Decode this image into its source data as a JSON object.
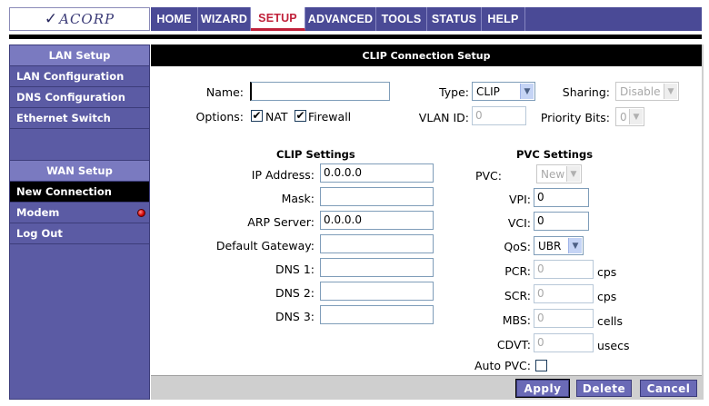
{
  "logo": {
    "text": "ACORP"
  },
  "nav": {
    "items": [
      "HOME",
      "WIZARD",
      "SETUP",
      "ADVANCED",
      "TOOLS",
      "STATUS",
      "HELP"
    ],
    "active": "SETUP"
  },
  "sidebar": {
    "lan_header": "LAN Setup",
    "lan_items": [
      "LAN Configuration",
      "DNS Configuration",
      "Ethernet Switch"
    ],
    "wan_header": "WAN Setup",
    "wan_items": [
      "New Connection",
      "Modem",
      "Log Out"
    ]
  },
  "page": {
    "title": "CLIP Connection Setup"
  },
  "form": {
    "name_label": "Name:",
    "name_value": "",
    "type_label": "Type:",
    "type_value": "CLIP",
    "sharing_label": "Sharing:",
    "sharing_value": "Disable",
    "options_label": "Options:",
    "nat_label": "NAT",
    "nat_checked": "✔",
    "firewall_label": "Firewall",
    "firewall_checked": "✔",
    "vlan_label": "VLAN ID:",
    "vlan_value": "0",
    "priority_label": "Priority Bits:",
    "priority_value": "0"
  },
  "clip": {
    "title": "CLIP Settings",
    "ip_label": "IP Address:",
    "ip_value": "0.0.0.0",
    "mask_label": "Mask:",
    "mask_value": "",
    "arp_label": "ARP Server:",
    "arp_value": "0.0.0.0",
    "gw_label": "Default Gateway:",
    "gw_value": "",
    "dns1_label": "DNS 1:",
    "dns1_value": "",
    "dns2_label": "DNS 2:",
    "dns2_value": "",
    "dns3_label": "DNS 3:",
    "dns3_value": ""
  },
  "pvc": {
    "title": "PVC Settings",
    "pvc_label": "PVC:",
    "pvc_value": "New",
    "vpi_label": "VPI:",
    "vpi_value": "0",
    "vci_label": "VCI:",
    "vci_value": "0",
    "qos_label": "QoS:",
    "qos_value": "UBR",
    "pcr_label": "PCR:",
    "pcr_value": "0",
    "pcr_unit": "cps",
    "scr_label": "SCR:",
    "scr_value": "0",
    "scr_unit": "cps",
    "mbs_label": "MBS:",
    "mbs_value": "0",
    "mbs_unit": "cells",
    "cdvt_label": "CDVT:",
    "cdvt_value": "0",
    "cdvt_unit": "usecs",
    "auto_label": "Auto PVC:"
  },
  "buttons": {
    "apply": "Apply",
    "delete": "Delete",
    "cancel": "Cancel"
  },
  "colors": {
    "nav_bg": "#4a4a96",
    "sidebar_bg": "#5b5ba4",
    "active_tab_text": "#c0213a",
    "button_bg": "#6a6ab6",
    "led": "#d00000"
  }
}
